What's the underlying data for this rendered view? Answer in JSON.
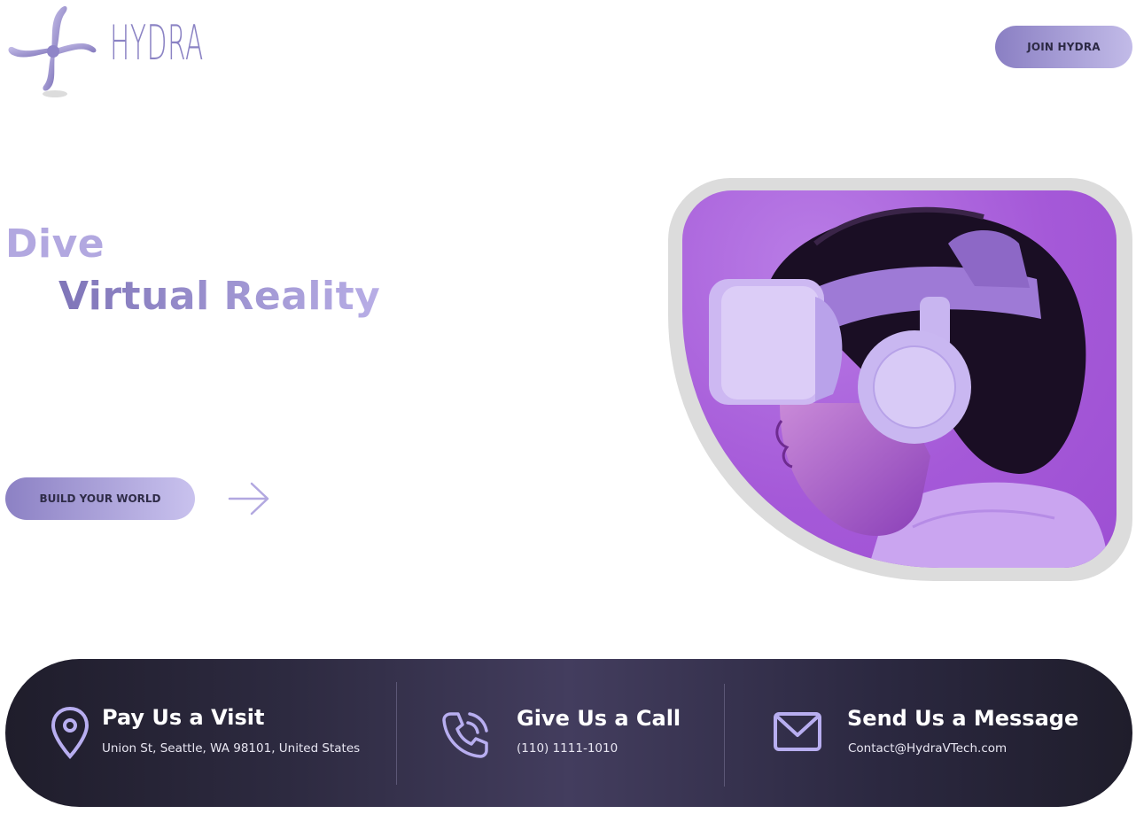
{
  "brand": {
    "name": "HYDRA",
    "color": "#8b83c4"
  },
  "header": {
    "join_label": "JOIN HYDRA"
  },
  "hero": {
    "line1": "Dive",
    "line2": "Virtual Reality",
    "cta_label": "BUILD YOUR WORLD",
    "arrow_icon": "arrow-right-icon",
    "image_subject": "person-wearing-vr-headset"
  },
  "contact": {
    "visit": {
      "title": "Pay Us a Visit",
      "text": "Union St, Seattle, WA 98101, United States",
      "icon": "location-pin-icon"
    },
    "call": {
      "title": "Give Us a Call",
      "text": "(110) 1111-1010",
      "icon": "phone-icon"
    },
    "message": {
      "title": "Send Us a Message",
      "text": "Contact@HydraVTech.com",
      "icon": "envelope-icon"
    }
  },
  "colors": {
    "accent": "#b2a8e0",
    "accent_dark": "#7f75b8",
    "photo_bg": "#a559d8",
    "footer_bg": "#2b2840"
  }
}
